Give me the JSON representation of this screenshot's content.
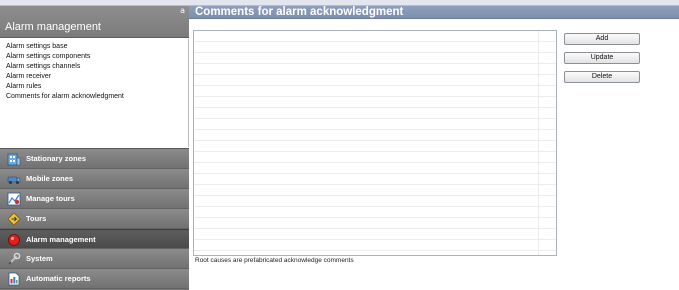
{
  "left_panel": {
    "pin_glyph": "a",
    "title": "Alarm management",
    "items": [
      {
        "label": "Alarm settings base"
      },
      {
        "label": "Alarm settings components"
      },
      {
        "label": "Alarm settings channels"
      },
      {
        "label": "Alarm receiver"
      },
      {
        "label": "Alarm rules"
      },
      {
        "label": "Comments for alarm acknowledgment"
      }
    ]
  },
  "nav": {
    "items": [
      {
        "label": "Stationary zones",
        "icon": "stationary-zones-icon",
        "active": false
      },
      {
        "label": "Mobile zones",
        "icon": "mobile-zones-icon",
        "active": false
      },
      {
        "label": "Manage tours",
        "icon": "manage-tours-icon",
        "active": false
      },
      {
        "label": "Tours",
        "icon": "tours-icon",
        "active": false
      },
      {
        "label": "Alarm management",
        "icon": "alarm-icon",
        "active": true
      },
      {
        "label": "System",
        "icon": "system-icon",
        "active": false
      },
      {
        "label": "Automatic reports",
        "icon": "reports-icon",
        "active": false
      }
    ]
  },
  "main": {
    "title": "Comments for alarm acknowledgment",
    "buttons": {
      "add": "Add",
      "update": "Update",
      "delete": "Delete"
    },
    "footer": "Root causes are prefabricated acknowledge comments"
  },
  "colors": {
    "main_header": "#8396b5",
    "left_header": "#858585",
    "nav_bg": "#777777",
    "nav_active": "#555555"
  }
}
